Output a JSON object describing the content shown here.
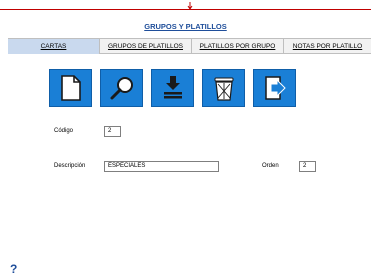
{
  "colors": {
    "accent": "#1f4e9a",
    "button_bg": "#1a7fd6",
    "active_tab": "#c9d9ee",
    "top_line": "#c00000"
  },
  "form": {
    "title": "GRUPOS Y PLATILLOS"
  },
  "tabs": [
    {
      "label": "CARTAS",
      "active": true
    },
    {
      "label": "GRUPOS DE PLATILLOS",
      "active": false
    },
    {
      "label": "PLATILLOS POR GRUPO",
      "active": false
    },
    {
      "label": "NOTAS POR PLATILLO",
      "active": false
    }
  ],
  "toolbar": {
    "buttons": [
      {
        "icon": "new-document-icon"
      },
      {
        "icon": "search-icon"
      },
      {
        "icon": "save-icon"
      },
      {
        "icon": "delete-icon"
      },
      {
        "icon": "exit-icon"
      }
    ]
  },
  "fields": {
    "codigo": {
      "label": "Código",
      "value": "2"
    },
    "descripcion": {
      "label": "Descripción",
      "value": "ESPECIALES"
    },
    "orden": {
      "label": "Orden",
      "value": "2"
    }
  },
  "help": {
    "label": "?"
  }
}
